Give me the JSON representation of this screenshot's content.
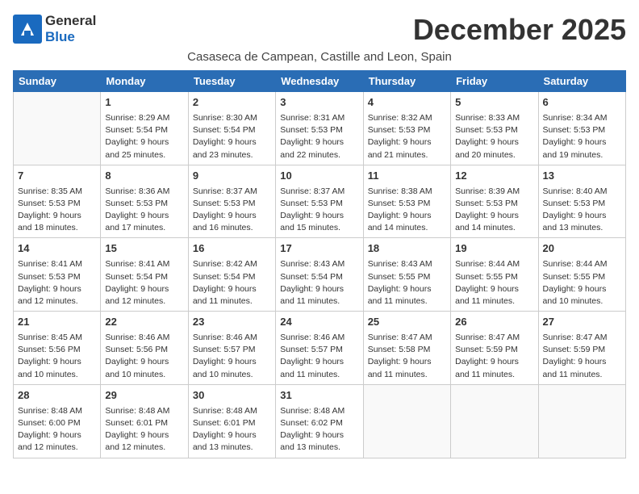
{
  "logo": {
    "general": "General",
    "blue": "Blue"
  },
  "title": "December 2025",
  "subtitle": "Casaseca de Campean, Castille and Leon, Spain",
  "days_of_week": [
    "Sunday",
    "Monday",
    "Tuesday",
    "Wednesday",
    "Thursday",
    "Friday",
    "Saturday"
  ],
  "weeks": [
    [
      {
        "day": null,
        "info": null
      },
      {
        "day": "1",
        "sunrise": "8:29 AM",
        "sunset": "5:54 PM",
        "daylight": "9 hours and 25 minutes."
      },
      {
        "day": "2",
        "sunrise": "8:30 AM",
        "sunset": "5:54 PM",
        "daylight": "9 hours and 23 minutes."
      },
      {
        "day": "3",
        "sunrise": "8:31 AM",
        "sunset": "5:53 PM",
        "daylight": "9 hours and 22 minutes."
      },
      {
        "day": "4",
        "sunrise": "8:32 AM",
        "sunset": "5:53 PM",
        "daylight": "9 hours and 21 minutes."
      },
      {
        "day": "5",
        "sunrise": "8:33 AM",
        "sunset": "5:53 PM",
        "daylight": "9 hours and 20 minutes."
      },
      {
        "day": "6",
        "sunrise": "8:34 AM",
        "sunset": "5:53 PM",
        "daylight": "9 hours and 19 minutes."
      }
    ],
    [
      {
        "day": "7",
        "sunrise": "8:35 AM",
        "sunset": "5:53 PM",
        "daylight": "9 hours and 18 minutes."
      },
      {
        "day": "8",
        "sunrise": "8:36 AM",
        "sunset": "5:53 PM",
        "daylight": "9 hours and 17 minutes."
      },
      {
        "day": "9",
        "sunrise": "8:37 AM",
        "sunset": "5:53 PM",
        "daylight": "9 hours and 16 minutes."
      },
      {
        "day": "10",
        "sunrise": "8:37 AM",
        "sunset": "5:53 PM",
        "daylight": "9 hours and 15 minutes."
      },
      {
        "day": "11",
        "sunrise": "8:38 AM",
        "sunset": "5:53 PM",
        "daylight": "9 hours and 14 minutes."
      },
      {
        "day": "12",
        "sunrise": "8:39 AM",
        "sunset": "5:53 PM",
        "daylight": "9 hours and 14 minutes."
      },
      {
        "day": "13",
        "sunrise": "8:40 AM",
        "sunset": "5:53 PM",
        "daylight": "9 hours and 13 minutes."
      }
    ],
    [
      {
        "day": "14",
        "sunrise": "8:41 AM",
        "sunset": "5:53 PM",
        "daylight": "9 hours and 12 minutes."
      },
      {
        "day": "15",
        "sunrise": "8:41 AM",
        "sunset": "5:54 PM",
        "daylight": "9 hours and 12 minutes."
      },
      {
        "day": "16",
        "sunrise": "8:42 AM",
        "sunset": "5:54 PM",
        "daylight": "9 hours and 11 minutes."
      },
      {
        "day": "17",
        "sunrise": "8:43 AM",
        "sunset": "5:54 PM",
        "daylight": "9 hours and 11 minutes."
      },
      {
        "day": "18",
        "sunrise": "8:43 AM",
        "sunset": "5:55 PM",
        "daylight": "9 hours and 11 minutes."
      },
      {
        "day": "19",
        "sunrise": "8:44 AM",
        "sunset": "5:55 PM",
        "daylight": "9 hours and 11 minutes."
      },
      {
        "day": "20",
        "sunrise": "8:44 AM",
        "sunset": "5:55 PM",
        "daylight": "9 hours and 10 minutes."
      }
    ],
    [
      {
        "day": "21",
        "sunrise": "8:45 AM",
        "sunset": "5:56 PM",
        "daylight": "9 hours and 10 minutes."
      },
      {
        "day": "22",
        "sunrise": "8:46 AM",
        "sunset": "5:56 PM",
        "daylight": "9 hours and 10 minutes."
      },
      {
        "day": "23",
        "sunrise": "8:46 AM",
        "sunset": "5:57 PM",
        "daylight": "9 hours and 10 minutes."
      },
      {
        "day": "24",
        "sunrise": "8:46 AM",
        "sunset": "5:57 PM",
        "daylight": "9 hours and 11 minutes."
      },
      {
        "day": "25",
        "sunrise": "8:47 AM",
        "sunset": "5:58 PM",
        "daylight": "9 hours and 11 minutes."
      },
      {
        "day": "26",
        "sunrise": "8:47 AM",
        "sunset": "5:59 PM",
        "daylight": "9 hours and 11 minutes."
      },
      {
        "day": "27",
        "sunrise": "8:47 AM",
        "sunset": "5:59 PM",
        "daylight": "9 hours and 11 minutes."
      }
    ],
    [
      {
        "day": "28",
        "sunrise": "8:48 AM",
        "sunset": "6:00 PM",
        "daylight": "9 hours and 12 minutes."
      },
      {
        "day": "29",
        "sunrise": "8:48 AM",
        "sunset": "6:01 PM",
        "daylight": "9 hours and 12 minutes."
      },
      {
        "day": "30",
        "sunrise": "8:48 AM",
        "sunset": "6:01 PM",
        "daylight": "9 hours and 13 minutes."
      },
      {
        "day": "31",
        "sunrise": "8:48 AM",
        "sunset": "6:02 PM",
        "daylight": "9 hours and 13 minutes."
      },
      {
        "day": null,
        "info": null
      },
      {
        "day": null,
        "info": null
      },
      {
        "day": null,
        "info": null
      }
    ]
  ]
}
